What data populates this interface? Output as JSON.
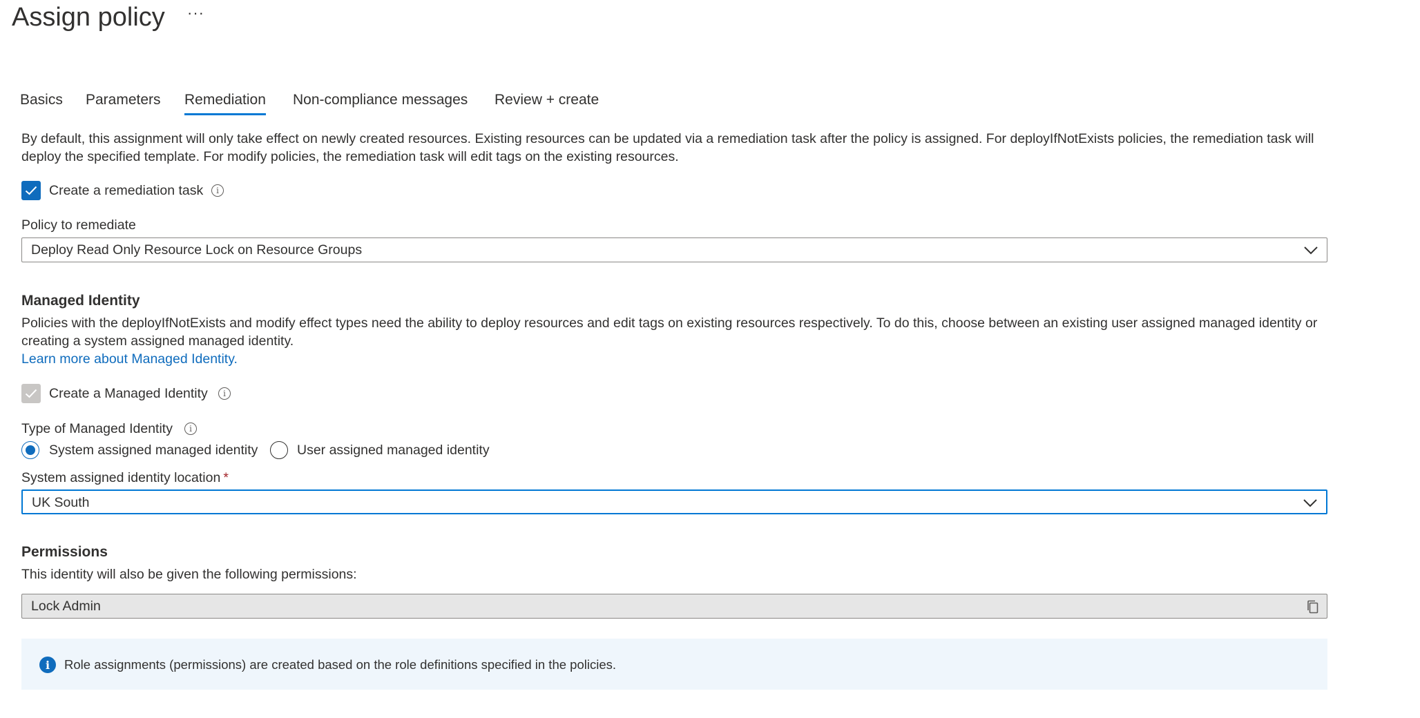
{
  "page": {
    "title": "Assign policy",
    "more_label": "···"
  },
  "tabs": [
    {
      "label": "Basics",
      "active": false
    },
    {
      "label": "Parameters",
      "active": false
    },
    {
      "label": "Remediation",
      "active": true
    },
    {
      "label": "Non-compliance messages",
      "active": false
    },
    {
      "label": "Review + create",
      "active": false
    }
  ],
  "remediation": {
    "intro_line1": "By default, this assignment will only take effect on newly created resources. Existing resources can be updated via a remediation task after the policy is assigned. For deployIfNotExists policies, the remediation task will",
    "intro_line2": "deploy the specified template. For modify policies, the remediation task will edit tags on the existing resources.",
    "create_task_label": "Create a remediation task",
    "create_task_checked": true,
    "policy_label": "Policy to remediate",
    "policy_value": "Deploy Read Only Resource Lock on Resource Groups"
  },
  "managed_identity": {
    "heading": "Managed Identity",
    "desc_line1": "Policies with the deployIfNotExists and modify effect types need the ability to deploy resources and edit tags on existing resources respectively. To do this, choose between an existing user assigned managed identity or",
    "desc_line2": "creating a system assigned managed identity.",
    "learn_more": "Learn more about Managed Identity.",
    "create_identity_label": "Create a Managed Identity",
    "create_identity_checked": true,
    "create_identity_disabled": true,
    "type_label": "Type of Managed Identity",
    "options": [
      {
        "label": "System assigned managed identity",
        "selected": true
      },
      {
        "label": "User assigned managed identity",
        "selected": false
      }
    ],
    "location_label": "System assigned identity location",
    "location_required_mark": "*",
    "location_value": "UK South"
  },
  "permissions": {
    "heading": "Permissions",
    "desc": "This identity will also be given the following permissions:",
    "value": "Lock Admin"
  },
  "info_bar": {
    "icon": "info-icon",
    "message": "Role assignments (permissions) are created based on the role definitions specified in the policies."
  },
  "colors": {
    "accent": "#0f6cbd",
    "tab_underline": "#0078d4",
    "required": "#a4262c",
    "info_bg": "#eff6fc"
  }
}
